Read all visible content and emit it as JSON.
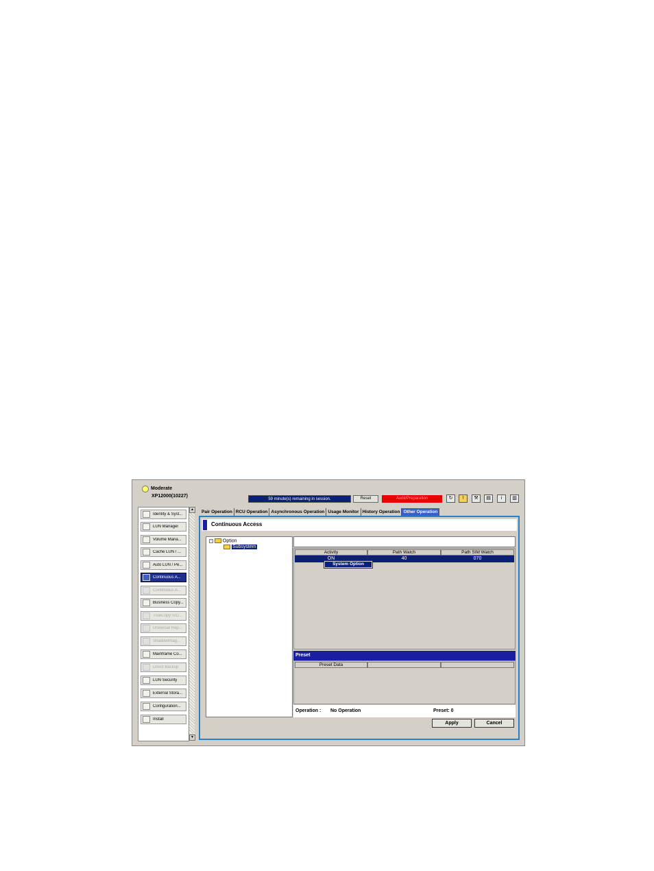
{
  "header": {
    "status_label": "Moderate",
    "subsystem": "XP12000(10227)",
    "session": "59 minute(s) remaining in session.",
    "reset_label": "Reset",
    "mode_label": "Audit/Preparation",
    "icons": [
      "refresh-icon",
      "alert-icon",
      "wrench-icon",
      "document-icon",
      "info-icon",
      "panel-icon"
    ]
  },
  "sidebar": {
    "items": [
      {
        "label": "Identity & Syst...",
        "icon": "identity-icon",
        "state": "normal"
      },
      {
        "label": "LUN Manager",
        "icon": "lun-manager-icon",
        "state": "normal"
      },
      {
        "label": "Volume Mana...",
        "icon": "volume-icon",
        "state": "normal"
      },
      {
        "label": "Cache LUN / ...",
        "icon": "cache-icon",
        "state": "normal"
      },
      {
        "label": "Auto LUN / Pe...",
        "icon": "auto-lun-icon",
        "state": "normal"
      },
      {
        "label": "Continuous A...",
        "icon": "continuous-access-icon",
        "state": "active"
      },
      {
        "label": "Continuous A...",
        "icon": "continuous-access-2-icon",
        "state": "disabled"
      },
      {
        "label": "Business Copy...",
        "icon": "business-copy-icon",
        "state": "normal"
      },
      {
        "label": "TrueCopy S/D...",
        "icon": "truecopy-icon",
        "state": "disabled"
      },
      {
        "label": "Universal Rep...",
        "icon": "universal-rep-icon",
        "state": "disabled"
      },
      {
        "label": "ShadowImag...",
        "icon": "shadowimage-icon",
        "state": "disabled"
      },
      {
        "label": "Mainframe Co...",
        "icon": "mainframe-icon",
        "state": "normal"
      },
      {
        "label": "Direct Backup",
        "icon": "backup-icon",
        "state": "disabled"
      },
      {
        "label": "LUN Security",
        "icon": "security-icon",
        "state": "normal"
      },
      {
        "label": "External Stora...",
        "icon": "external-storage-icon",
        "state": "normal"
      },
      {
        "label": "Configuration...",
        "icon": "configuration-icon",
        "state": "normal"
      },
      {
        "label": "Install",
        "icon": "install-icon",
        "state": "normal"
      }
    ]
  },
  "tabs": [
    {
      "label": "Pair Operation",
      "active": false
    },
    {
      "label": "RCU Operation",
      "active": false
    },
    {
      "label": "Asynchronous Operation",
      "active": false
    },
    {
      "label": "Usage Monitor",
      "active": false
    },
    {
      "label": "History Operation",
      "active": false
    },
    {
      "label": "Other Operation",
      "active": true
    }
  ],
  "main": {
    "title": "Continuous Access",
    "tree": {
      "root": "Option",
      "child": "Subsystem"
    },
    "table": {
      "columns": [
        "Activity",
        "Path Watch",
        "Path SIM Watch"
      ],
      "row": [
        "ON",
        "40",
        "070"
      ]
    },
    "context_menu": "System Option",
    "preset": {
      "title": "Preset",
      "columns": [
        "Preset Data",
        "",
        ""
      ]
    },
    "operation_label": "Operation :",
    "operation_value": "No Operation",
    "preset_count": "Preset: 0",
    "apply_label": "Apply",
    "cancel_label": "Cancel"
  },
  "colors": {
    "selection": "#0a1f7a",
    "preset_bar": "#1a1fa0",
    "mode_red": "#e80000",
    "active_tab": "#3a5fcd",
    "panel_border": "#2d7ec0"
  }
}
